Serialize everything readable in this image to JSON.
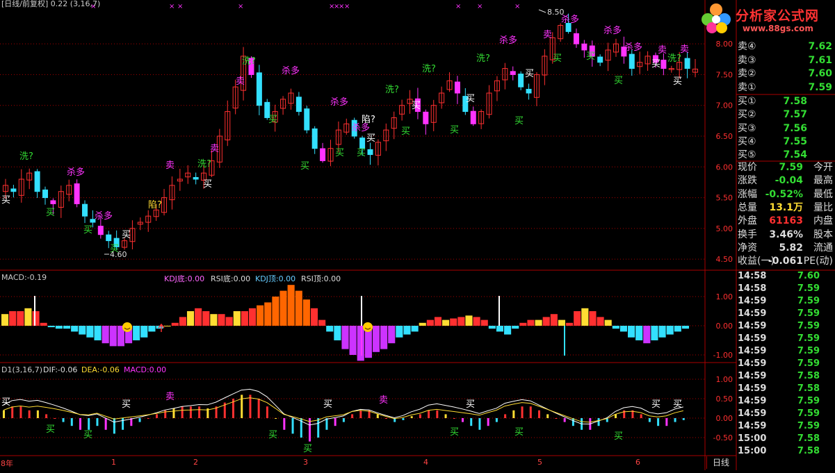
{
  "window_title": "[日线/前复权] 0.22 (3,16,7)",
  "logo": {
    "title": "分析家公式网",
    "url": "www.88gs.com"
  },
  "main_chart": {
    "price_ticks": [
      "8.00",
      "7.50",
      "7.00",
      "6.50",
      "6.00",
      "5.50",
      "5.00",
      "4.50"
    ],
    "high_label": "8.50",
    "low_label": "4.60",
    "buy_text": "买",
    "sell_text": "卖",
    "kill_text": "杀多",
    "wash_text": "洗?",
    "trap_text": "陷?"
  },
  "macd_panel": {
    "title": "MACD:-0.19",
    "kdj_bottom": "KDJ底:0.00",
    "rsi_bottom": "RSI底:0.00",
    "kdj_top": "KDJ顶:0.00",
    "rsi_top": "RSI顶:0.00",
    "ticks": [
      "1.00",
      "0.00",
      "-1.00"
    ]
  },
  "dif_panel": {
    "title": "D1(3,16,7)",
    "dif": "DIF:-0.06",
    "dea": "DEA:-0.06",
    "macd": "MACD:0.00",
    "ticks": [
      "1.00",
      "0.50",
      "0.00",
      "-0.50"
    ]
  },
  "x_axis": {
    "labels": [
      "8年",
      "1",
      "2",
      "3",
      "4",
      "5",
      "6"
    ],
    "period_button": "日线"
  },
  "quote": {
    "sell": [
      {
        "label": "卖④",
        "price": "7.62"
      },
      {
        "label": "卖③",
        "price": "7.61"
      },
      {
        "label": "卖②",
        "price": "7.60"
      },
      {
        "label": "卖①",
        "price": "7.59"
      }
    ],
    "buy": [
      {
        "label": "买①",
        "price": "7.58"
      },
      {
        "label": "买②",
        "price": "7.57"
      },
      {
        "label": "买③",
        "price": "7.56"
      },
      {
        "label": "买④",
        "price": "7.55"
      },
      {
        "label": "买⑤",
        "price": "7.54"
      }
    ],
    "stats": [
      {
        "label": "现价",
        "value": "7.59",
        "label2": "今开"
      },
      {
        "label": "涨跌",
        "value": "-0.04",
        "label2": "最高"
      },
      {
        "label": "涨幅",
        "value": "-0.52%",
        "label2": "最低"
      },
      {
        "label": "总量",
        "value": "13.1万",
        "label2": "量比"
      },
      {
        "label": "外盘",
        "value": "61163",
        "label2": "内盘"
      },
      {
        "label": "换手",
        "value": "3.46%",
        "label2": "股本"
      },
      {
        "label": "净资",
        "value": "5.82",
        "label2": "流通"
      },
      {
        "label": "收益(一)",
        "value": "-0.061",
        "label2": "PE(动)"
      }
    ],
    "ticks": [
      {
        "time": "14:58",
        "price": "7.60"
      },
      {
        "time": "14:58",
        "price": "7.59"
      },
      {
        "time": "14:59",
        "price": "7.59"
      },
      {
        "time": "14:59",
        "price": "7.59"
      },
      {
        "time": "14:59",
        "price": "7.59"
      },
      {
        "time": "14:59",
        "price": "7.59"
      },
      {
        "time": "14:59",
        "price": "7.59"
      },
      {
        "time": "14:59",
        "price": "7.59"
      },
      {
        "time": "14:59",
        "price": "7.58"
      },
      {
        "time": "14:59",
        "price": "7.58"
      },
      {
        "time": "14:59",
        "price": "7.59"
      },
      {
        "time": "14:59",
        "price": "7.59"
      },
      {
        "time": "14:59",
        "price": "7.59"
      },
      {
        "time": "15:00",
        "price": "7.58"
      },
      {
        "time": "15:00",
        "price": "7.58"
      }
    ]
  },
  "colors": {
    "up": "#ff3030",
    "down": "#33e0ff",
    "magenta": "#ff33ff",
    "grid": "#aa0000",
    "yellow": "#ffdd33",
    "green": "#33dd33"
  },
  "chart_data": {
    "type": "candlestick",
    "close_series": [
      5.7,
      5.6,
      5.8,
      5.9,
      5.6,
      5.5,
      5.4,
      5.6,
      5.7,
      5.4,
      5.2,
      5.1,
      4.9,
      4.8,
      4.7,
      4.8,
      5.0,
      5.1,
      5.2,
      5.3,
      5.5,
      5.7,
      5.8,
      5.9,
      5.8,
      5.9,
      6.1,
      6.5,
      6.9,
      7.3,
      7.8,
      7.5,
      7.0,
      6.8,
      6.9,
      7.1,
      7.2,
      6.9,
      6.6,
      6.3,
      6.1,
      6.3,
      6.6,
      6.7,
      6.5,
      6.3,
      6.2,
      6.4,
      6.6,
      6.8,
      7.0,
      7.1,
      6.9,
      6.7,
      7.0,
      7.2,
      7.4,
      7.2,
      6.9,
      6.7,
      6.9,
      7.2,
      7.4,
      7.6,
      7.5,
      7.3,
      7.2,
      7.5,
      7.8,
      8.1,
      8.3,
      8.2,
      8.0,
      7.9,
      7.8,
      7.7,
      7.9,
      8.0,
      7.8,
      7.6,
      7.7,
      7.8,
      7.7,
      7.6,
      7.6,
      7.7,
      7.6,
      7.59
    ],
    "ylim": [
      4.4,
      8.6
    ]
  }
}
